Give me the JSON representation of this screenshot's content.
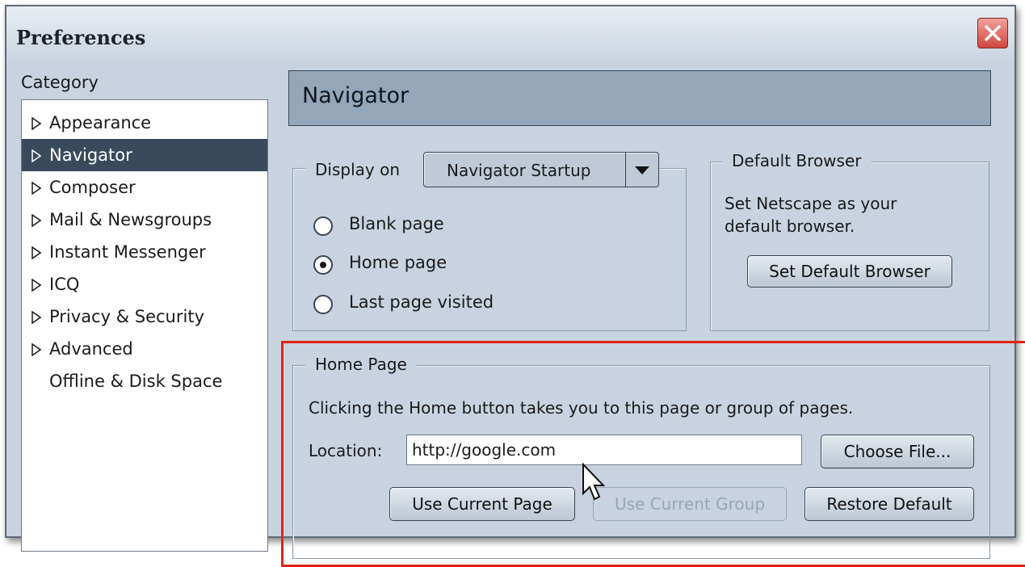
{
  "window": {
    "title": "Preferences"
  },
  "sidebar": {
    "label": "Category",
    "items": [
      {
        "label": "Appearance",
        "expandable": true,
        "selected": false
      },
      {
        "label": "Navigator",
        "expandable": true,
        "selected": true
      },
      {
        "label": "Composer",
        "expandable": true,
        "selected": false
      },
      {
        "label": "Mail & Newsgroups",
        "expandable": true,
        "selected": false
      },
      {
        "label": "Instant Messenger",
        "expandable": true,
        "selected": false
      },
      {
        "label": "ICQ",
        "expandable": true,
        "selected": false
      },
      {
        "label": "Privacy & Security",
        "expandable": true,
        "selected": false
      },
      {
        "label": "Advanced",
        "expandable": true,
        "selected": false
      },
      {
        "label": "Offline & Disk Space",
        "expandable": false,
        "selected": false
      }
    ]
  },
  "panel": {
    "header": "Navigator",
    "display_on": {
      "label": "Display on",
      "selected_option": "Navigator Startup",
      "options": [
        {
          "label": "Blank page",
          "checked": false
        },
        {
          "label": "Home page",
          "checked": true
        },
        {
          "label": "Last page visited",
          "checked": false
        }
      ]
    },
    "default_browser": {
      "title": "Default Browser",
      "description_line1": "Set Netscape as your",
      "description_line2": "default browser.",
      "button": "Set Default Browser"
    },
    "home_page": {
      "title": "Home Page",
      "description": "Clicking the Home button takes you to this page or group of pages.",
      "location_label": "Location:",
      "location_value": "http://google.com",
      "choose_file": "Choose File...",
      "use_current_page": "Use Current Page",
      "use_current_group": "Use Current Group",
      "restore_default": "Restore Default"
    }
  },
  "colors": {
    "window_bg": "#c9d3df",
    "header_bg": "#93a6ba",
    "selected_bg": "#3a4a5c",
    "highlight": "#e2231a"
  }
}
